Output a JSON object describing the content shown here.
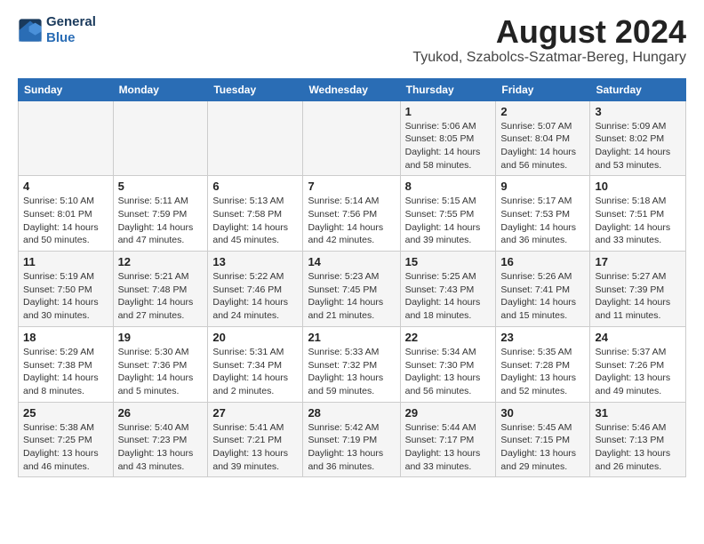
{
  "header": {
    "logo_line1": "General",
    "logo_line2": "Blue",
    "month_title": "August 2024",
    "subtitle": "Tyukod, Szabolcs-Szatmar-Bereg, Hungary"
  },
  "days_of_week": [
    "Sunday",
    "Monday",
    "Tuesday",
    "Wednesday",
    "Thursday",
    "Friday",
    "Saturday"
  ],
  "weeks": [
    [
      {
        "day": "",
        "detail": ""
      },
      {
        "day": "",
        "detail": ""
      },
      {
        "day": "",
        "detail": ""
      },
      {
        "day": "",
        "detail": ""
      },
      {
        "day": "1",
        "detail": "Sunrise: 5:06 AM\nSunset: 8:05 PM\nDaylight: 14 hours\nand 58 minutes."
      },
      {
        "day": "2",
        "detail": "Sunrise: 5:07 AM\nSunset: 8:04 PM\nDaylight: 14 hours\nand 56 minutes."
      },
      {
        "day": "3",
        "detail": "Sunrise: 5:09 AM\nSunset: 8:02 PM\nDaylight: 14 hours\nand 53 minutes."
      }
    ],
    [
      {
        "day": "4",
        "detail": "Sunrise: 5:10 AM\nSunset: 8:01 PM\nDaylight: 14 hours\nand 50 minutes."
      },
      {
        "day": "5",
        "detail": "Sunrise: 5:11 AM\nSunset: 7:59 PM\nDaylight: 14 hours\nand 47 minutes."
      },
      {
        "day": "6",
        "detail": "Sunrise: 5:13 AM\nSunset: 7:58 PM\nDaylight: 14 hours\nand 45 minutes."
      },
      {
        "day": "7",
        "detail": "Sunrise: 5:14 AM\nSunset: 7:56 PM\nDaylight: 14 hours\nand 42 minutes."
      },
      {
        "day": "8",
        "detail": "Sunrise: 5:15 AM\nSunset: 7:55 PM\nDaylight: 14 hours\nand 39 minutes."
      },
      {
        "day": "9",
        "detail": "Sunrise: 5:17 AM\nSunset: 7:53 PM\nDaylight: 14 hours\nand 36 minutes."
      },
      {
        "day": "10",
        "detail": "Sunrise: 5:18 AM\nSunset: 7:51 PM\nDaylight: 14 hours\nand 33 minutes."
      }
    ],
    [
      {
        "day": "11",
        "detail": "Sunrise: 5:19 AM\nSunset: 7:50 PM\nDaylight: 14 hours\nand 30 minutes."
      },
      {
        "day": "12",
        "detail": "Sunrise: 5:21 AM\nSunset: 7:48 PM\nDaylight: 14 hours\nand 27 minutes."
      },
      {
        "day": "13",
        "detail": "Sunrise: 5:22 AM\nSunset: 7:46 PM\nDaylight: 14 hours\nand 24 minutes."
      },
      {
        "day": "14",
        "detail": "Sunrise: 5:23 AM\nSunset: 7:45 PM\nDaylight: 14 hours\nand 21 minutes."
      },
      {
        "day": "15",
        "detail": "Sunrise: 5:25 AM\nSunset: 7:43 PM\nDaylight: 14 hours\nand 18 minutes."
      },
      {
        "day": "16",
        "detail": "Sunrise: 5:26 AM\nSunset: 7:41 PM\nDaylight: 14 hours\nand 15 minutes."
      },
      {
        "day": "17",
        "detail": "Sunrise: 5:27 AM\nSunset: 7:39 PM\nDaylight: 14 hours\nand 11 minutes."
      }
    ],
    [
      {
        "day": "18",
        "detail": "Sunrise: 5:29 AM\nSunset: 7:38 PM\nDaylight: 14 hours\nand 8 minutes."
      },
      {
        "day": "19",
        "detail": "Sunrise: 5:30 AM\nSunset: 7:36 PM\nDaylight: 14 hours\nand 5 minutes."
      },
      {
        "day": "20",
        "detail": "Sunrise: 5:31 AM\nSunset: 7:34 PM\nDaylight: 14 hours\nand 2 minutes."
      },
      {
        "day": "21",
        "detail": "Sunrise: 5:33 AM\nSunset: 7:32 PM\nDaylight: 13 hours\nand 59 minutes."
      },
      {
        "day": "22",
        "detail": "Sunrise: 5:34 AM\nSunset: 7:30 PM\nDaylight: 13 hours\nand 56 minutes."
      },
      {
        "day": "23",
        "detail": "Sunrise: 5:35 AM\nSunset: 7:28 PM\nDaylight: 13 hours\nand 52 minutes."
      },
      {
        "day": "24",
        "detail": "Sunrise: 5:37 AM\nSunset: 7:26 PM\nDaylight: 13 hours\nand 49 minutes."
      }
    ],
    [
      {
        "day": "25",
        "detail": "Sunrise: 5:38 AM\nSunset: 7:25 PM\nDaylight: 13 hours\nand 46 minutes."
      },
      {
        "day": "26",
        "detail": "Sunrise: 5:40 AM\nSunset: 7:23 PM\nDaylight: 13 hours\nand 43 minutes."
      },
      {
        "day": "27",
        "detail": "Sunrise: 5:41 AM\nSunset: 7:21 PM\nDaylight: 13 hours\nand 39 minutes."
      },
      {
        "day": "28",
        "detail": "Sunrise: 5:42 AM\nSunset: 7:19 PM\nDaylight: 13 hours\nand 36 minutes."
      },
      {
        "day": "29",
        "detail": "Sunrise: 5:44 AM\nSunset: 7:17 PM\nDaylight: 13 hours\nand 33 minutes."
      },
      {
        "day": "30",
        "detail": "Sunrise: 5:45 AM\nSunset: 7:15 PM\nDaylight: 13 hours\nand 29 minutes."
      },
      {
        "day": "31",
        "detail": "Sunrise: 5:46 AM\nSunset: 7:13 PM\nDaylight: 13 hours\nand 26 minutes."
      }
    ]
  ]
}
